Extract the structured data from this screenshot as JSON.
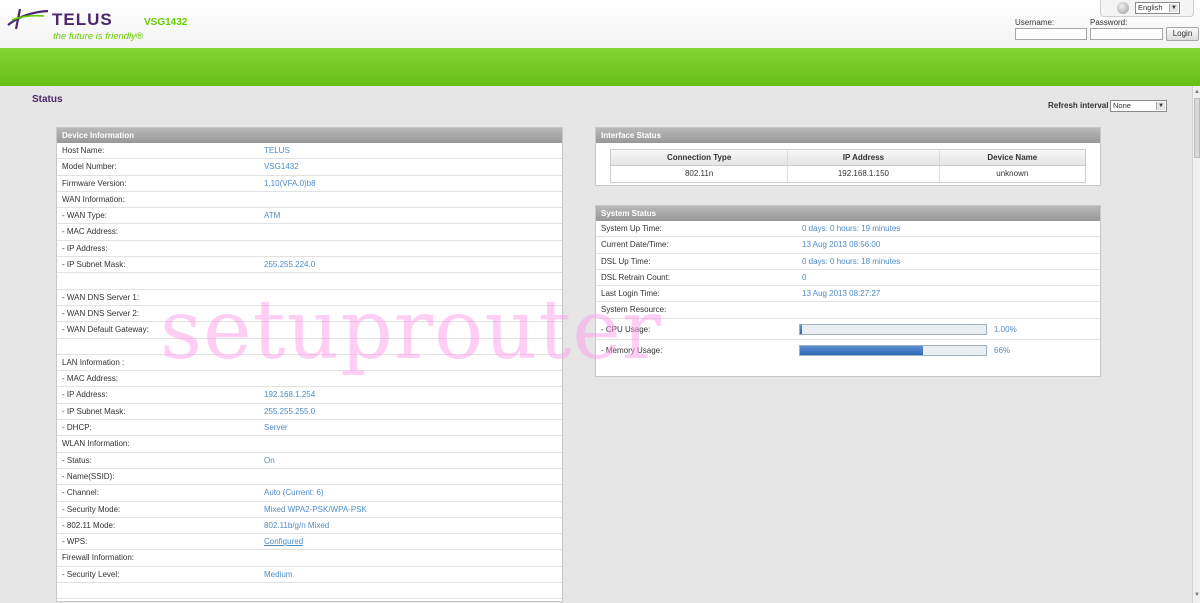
{
  "header": {
    "logo_text": "TELUS",
    "tagline": "the future is friendly®",
    "model": "VSG1432",
    "language": "English",
    "username_label": "Username:",
    "password_label": "Password:",
    "login_label": "Login"
  },
  "page": {
    "title": "Status",
    "refresh_label": "Refresh interval :",
    "refresh_value": "None"
  },
  "device_info": {
    "title": "Device Information",
    "rows": [
      {
        "k": "Host Name:",
        "v": "TELUS"
      },
      {
        "k": "Model Number:",
        "v": "VSG1432"
      },
      {
        "k": "Firmware Version:",
        "v": "1.10(VFA.0)b8"
      },
      {
        "k": "WAN Information:",
        "v": ""
      },
      {
        "k": " - WAN Type:",
        "v": "ATM"
      },
      {
        "k": " - MAC Address:",
        "v": ""
      },
      {
        "k": " - IP Address:",
        "v": ""
      },
      {
        "k": " - IP Subnet Mask:",
        "v": "255.255.224.0"
      },
      {
        "k": "",
        "v": ""
      },
      {
        "k": " - WAN DNS Server 1:",
        "v": ""
      },
      {
        "k": " - WAN DNS Server 2:",
        "v": ""
      },
      {
        "k": " - WAN Default Gateway:",
        "v": ""
      },
      {
        "k": "",
        "v": ""
      },
      {
        "k": "LAN Information :",
        "v": ""
      },
      {
        "k": " - MAC Address:",
        "v": ""
      },
      {
        "k": " - IP Address:",
        "v": "192.168.1.254"
      },
      {
        "k": " - IP Subnet Mask:",
        "v": "255.255.255.0"
      },
      {
        "k": " - DHCP:",
        "v": "Server"
      },
      {
        "k": "WLAN Information:",
        "v": ""
      },
      {
        "k": " - Status:",
        "v": "On"
      },
      {
        "k": " - Name(SSID):",
        "v": ""
      },
      {
        "k": " - Channel:",
        "v": "Auto (Current: 6)"
      },
      {
        "k": " - Security Mode:",
        "v": "Mixed WPA2-PSK/WPA-PSK"
      },
      {
        "k": " - 802.11 Mode:",
        "v": "802.11b/g/n Mixed"
      },
      {
        "k": " - WPS:",
        "v": "Configured"
      },
      {
        "k": "Firewall Information:",
        "v": ""
      },
      {
        "k": " - Security Level:",
        "v": "Medium"
      },
      {
        "k": "",
        "v": ""
      }
    ]
  },
  "interface_status": {
    "title": "Interface Status",
    "columns": [
      "Connection Type",
      "IP Address",
      "Device Name"
    ],
    "rows": [
      [
        "802.11n",
        "192.168.1.150",
        "unknown"
      ]
    ]
  },
  "system_status": {
    "title": "System Status",
    "rows": [
      {
        "k": "System Up Time:",
        "v": "0 days: 0 hours: 19 minutes"
      },
      {
        "k": "Current Date/Time:",
        "v": "13 Aug 2013 08:56:00"
      },
      {
        "k": "DSL Up Time:",
        "v": "0 days: 0 hours: 18 minutes"
      },
      {
        "k": "DSL Retrain Count:",
        "v": "0"
      },
      {
        "k": "Last Login Time:",
        "v": "13 Aug 2013 08:27:27"
      },
      {
        "k": "System Resource:",
        "v": ""
      }
    ],
    "cpu": {
      "label": " - CPU Usage:",
      "value": 1.0,
      "text": "1.00%"
    },
    "memory": {
      "label": " - Memory Usage:",
      "value": 66,
      "text": "66%"
    }
  },
  "watermark": "setuprouter"
}
